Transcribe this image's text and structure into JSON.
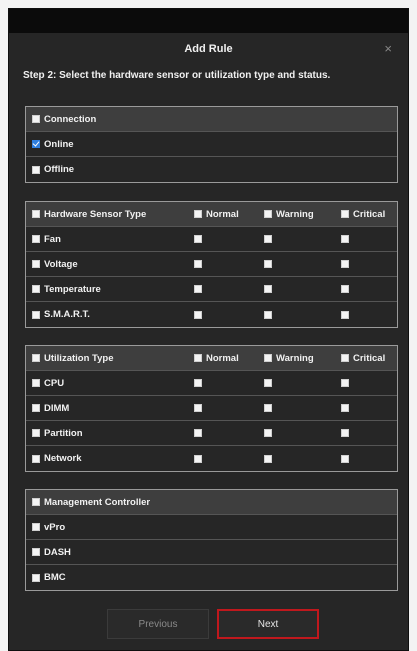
{
  "dialog": {
    "title": "Add Rule",
    "close_glyph": "×",
    "step_text": "Step 2: Select the hardware sensor or utilization type and status."
  },
  "connection": {
    "header": "Connection",
    "items": [
      {
        "label": "Online",
        "checked": true
      },
      {
        "label": "Offline",
        "checked": false
      }
    ]
  },
  "hardware": {
    "header": "Hardware Sensor Type",
    "columns": [
      "Normal",
      "Warning",
      "Critical"
    ],
    "rows": [
      {
        "label": "Fan"
      },
      {
        "label": "Voltage"
      },
      {
        "label": "Temperature"
      },
      {
        "label": "S.M.A.R.T."
      }
    ]
  },
  "utilization": {
    "header": "Utilization Type",
    "columns": [
      "Normal",
      "Warning",
      "Critical"
    ],
    "rows": [
      {
        "label": "CPU"
      },
      {
        "label": "DIMM"
      },
      {
        "label": "Partition"
      },
      {
        "label": "Network"
      }
    ]
  },
  "management": {
    "header": "Management Controller",
    "items": [
      {
        "label": "vPro"
      },
      {
        "label": "DASH"
      },
      {
        "label": "BMC"
      }
    ]
  },
  "buttons": {
    "previous": "Previous",
    "next": "Next"
  },
  "colors": {
    "dialog_bg": "#262626",
    "header_row_bg": "#3e3e3e",
    "checkbox_checked": "#2f7fe0",
    "next_border": "#c0181d"
  }
}
